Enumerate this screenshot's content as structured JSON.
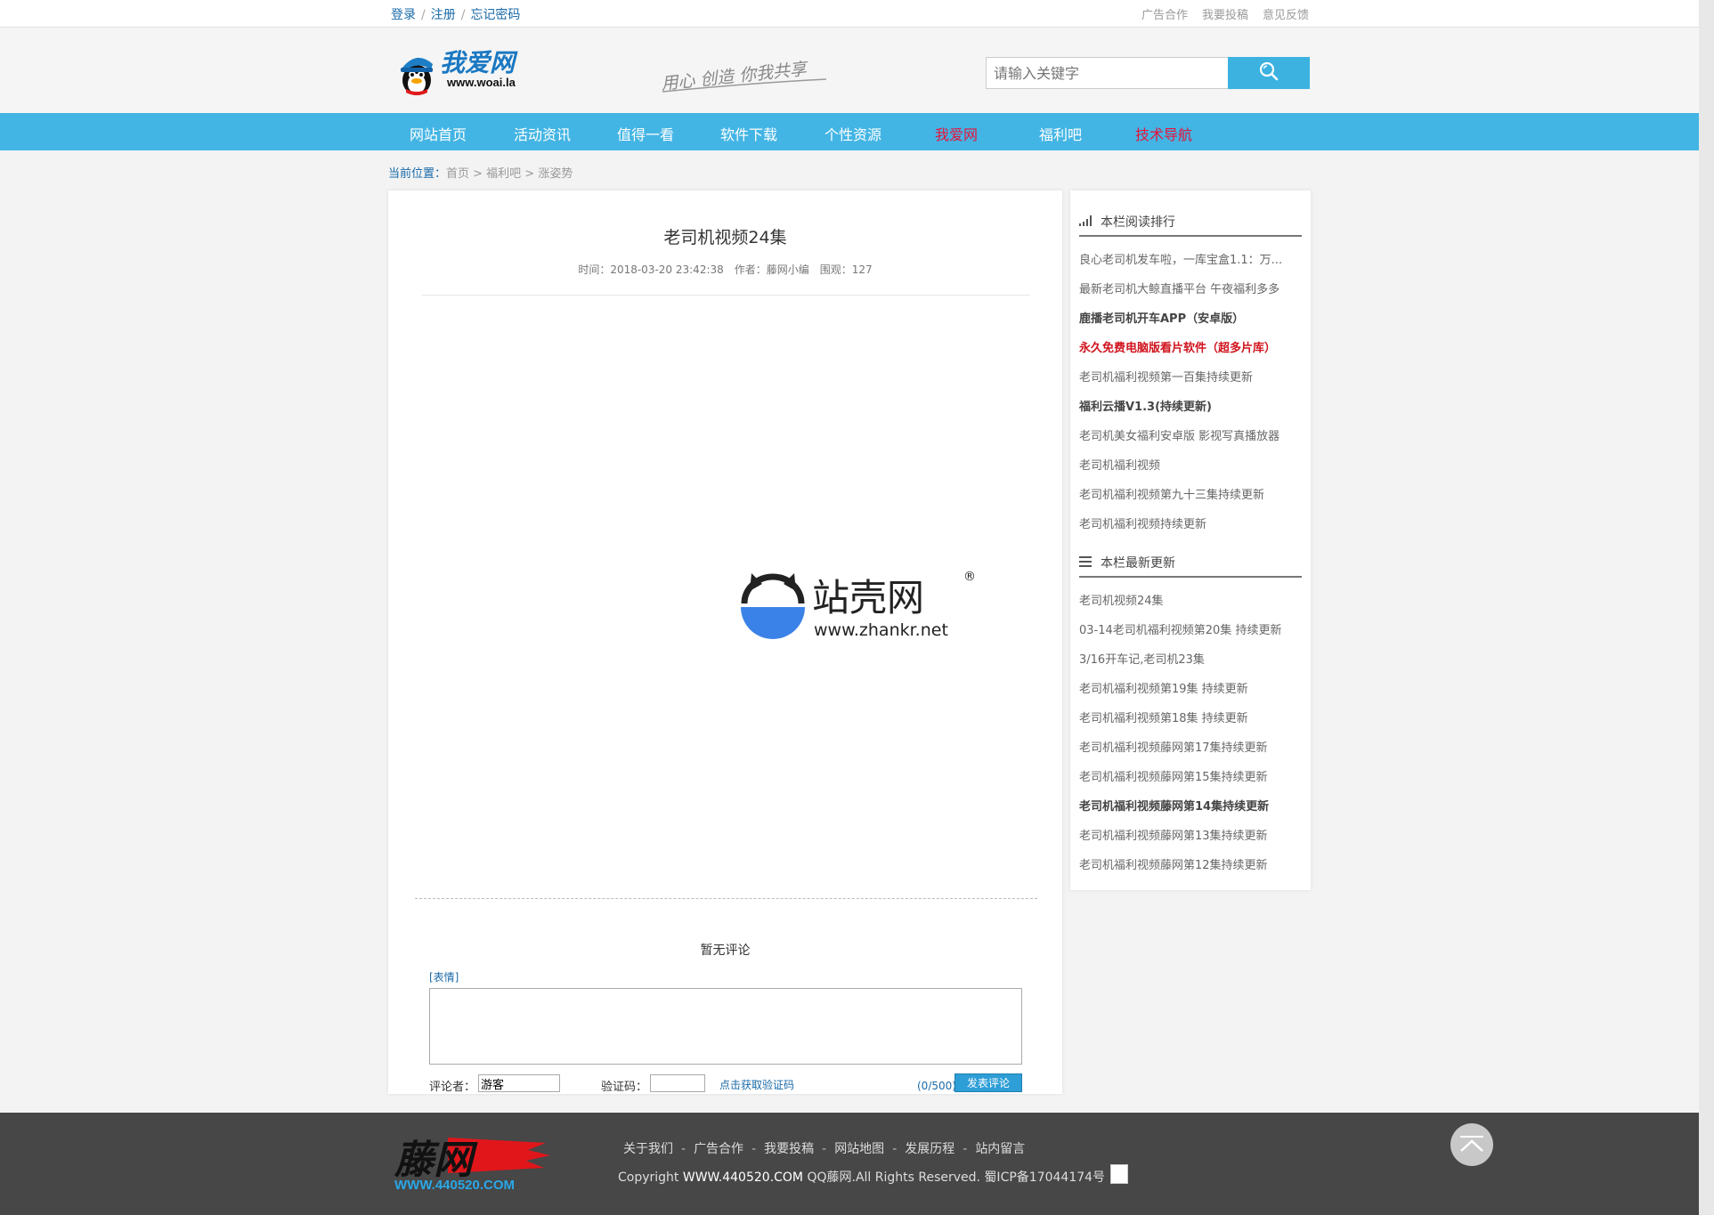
{
  "topbar": {
    "login": "登录",
    "register": "注册",
    "forgot": "忘记密码",
    "sep": "/",
    "links": [
      "广告合作",
      "我要投稿",
      "意见反馈"
    ]
  },
  "header": {
    "logo_text": "我爱网",
    "logo_url": "www.woai.la",
    "slogan": "用心 创造 你我共享",
    "search_placeholder": "请输入关键字"
  },
  "nav": {
    "items": [
      {
        "label": "网站首页"
      },
      {
        "label": "活动资讯"
      },
      {
        "label": "值得一看"
      },
      {
        "label": "软件下载"
      },
      {
        "label": "个性资源"
      },
      {
        "label": "我爱网"
      },
      {
        "label": "福利吧"
      },
      {
        "label": "技术导航"
      }
    ]
  },
  "breadcrumb": {
    "label": "当前位置：",
    "path": "首页 > 福利吧 > 涨姿势"
  },
  "article": {
    "title": "老司机视频24集",
    "time": "时间：2018-03-20 23:42:38",
    "author": "作者：藤网小编",
    "views": "围观：127",
    "watermark_name": "站壳网",
    "watermark_url": "www.zhankr.net",
    "watermark_reg": "®"
  },
  "comments": {
    "empty": "暂无评论",
    "emoji": "[表情]",
    "commenter_label": "评论者：",
    "commenter_value": "游客",
    "captcha_label": "验证码：",
    "get_captcha": "点击获取验证码",
    "count": "(0/500)",
    "submit": "发表评论"
  },
  "sidebar": {
    "ranking_title": "本栏阅读排行",
    "ranking": [
      {
        "text": "良心老司机发车啦，一库宝盒1.1：万..."
      },
      {
        "text": "最新老司机大鲸直播平台 午夜福利多多"
      },
      {
        "text": "鹿播老司机开车APP（安卓版）"
      },
      {
        "text": "永久免费电脑版看片软件（超多片库）"
      },
      {
        "text": "老司机福利视频第一百集持续更新"
      },
      {
        "text": "福利云播V1.3(持续更新)"
      },
      {
        "text": "老司机美女福利安卓版 影视写真播放器"
      },
      {
        "text": "老司机福利视频"
      },
      {
        "text": "老司机福利视频第九十三集持续更新"
      },
      {
        "text": "老司机福利视频持续更新"
      }
    ],
    "latest_title": "本栏最新更新",
    "latest": [
      {
        "text": "老司机视频24集"
      },
      {
        "text": "03-14老司机福利视频第20集 持续更新"
      },
      {
        "text": "3/16开车记,老司机23集"
      },
      {
        "text": "老司机福利视频第19集 持续更新"
      },
      {
        "text": "老司机福利视频第18集 持续更新"
      },
      {
        "text": "老司机福利视频藤网第17集持续更新"
      },
      {
        "text": "老司机福利视频藤网第15集持续更新"
      },
      {
        "text": "老司机福利视频藤网第14集持续更新"
      },
      {
        "text": "老司机福利视频藤网第13集持续更新"
      },
      {
        "text": "老司机福利视频藤网第12集持续更新"
      }
    ]
  },
  "footer": {
    "logo_text": "藤网",
    "logo_url": "WWW.440520.COM",
    "links": [
      "关于我们",
      "广告合作",
      "我要投稿",
      "网站地图",
      "发展历程",
      "站内留言"
    ],
    "link_sep": "-",
    "copyright_prefix": "Copyright",
    "copyright_site": "WWW.440520.COM",
    "copyright_rest": "QQ藤网.All Rights Reserved. 蜀ICP备17044174号"
  },
  "colors": {
    "nav_bg": "#43b5e4",
    "nav_highlight": "#e5143c",
    "link_blue": "#1a6aa8",
    "footer_bg": "#474747"
  },
  "icons": {
    "search": "search-icon",
    "ranking": "signal-bars-icon",
    "latest": "list-icon",
    "back_to_top": "chevron-up-icon"
  }
}
